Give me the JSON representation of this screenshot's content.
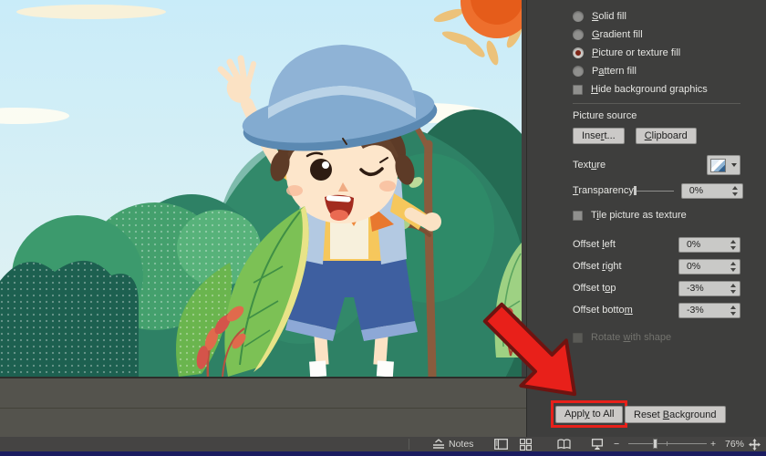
{
  "app": {
    "name": "PowerPoint Format Background pane"
  },
  "panel": {
    "fill_options": [
      {
        "pre": "",
        "mn": "S",
        "post": "olid fill",
        "selected": false
      },
      {
        "pre": "",
        "mn": "G",
        "post": "radient fill",
        "selected": false
      },
      {
        "pre": "",
        "mn": "P",
        "post": "icture or texture fill",
        "selected": true
      },
      {
        "pre": "P",
        "mn": "a",
        "post": "ttern fill",
        "selected": false
      }
    ],
    "selected_fill_option": "Picture or texture fill",
    "hide_bg": {
      "pre": "",
      "mn": "H",
      "post": "ide background graphics",
      "checked": false
    },
    "picture_source_label": "Picture source",
    "insert_btn": {
      "pre": "Inse",
      "mn": "r",
      "post": "t..."
    },
    "clipboard_btn": {
      "pre": "",
      "mn": "C",
      "post": "lipboard"
    },
    "texture_label": {
      "pre": "Text",
      "mn": "u",
      "post": "re"
    },
    "transparency_label": {
      "pre": "",
      "mn": "T",
      "post": "ransparency"
    },
    "transparency_value": "0%",
    "tile_label": {
      "pre": "T",
      "mn": "i",
      "post": "le picture as texture",
      "checked": false
    },
    "offsets": [
      {
        "label": {
          "pre": "Offset ",
          "mn": "l",
          "post": "eft"
        },
        "value": "0%"
      },
      {
        "label": {
          "pre": "Offset ",
          "mn": "r",
          "post": "ight"
        },
        "value": "0%"
      },
      {
        "label": {
          "pre": "Offset t",
          "mn": "o",
          "post": "p"
        },
        "value": "-3%"
      },
      {
        "label": {
          "pre": "Offset botto",
          "mn": "m",
          "post": ""
        },
        "value": "-3%"
      }
    ],
    "rotate_label": {
      "pre": "Rotate ",
      "mn": "w",
      "post": "ith shape",
      "disabled": true
    },
    "apply_btn": {
      "pre": "Appl",
      "mn": "y",
      "post": " to All"
    },
    "reset_btn": {
      "pre": "Reset ",
      "mn": "B",
      "post": "ackground"
    }
  },
  "status_bar": {
    "notes_label": "Notes",
    "zoom_out_glyph": "−",
    "zoom_in_glyph": "+",
    "zoom_level": "76%"
  },
  "icons": {
    "notes": "notes-collapse-icon",
    "normal_view": "normal-view-icon",
    "slide_sorter": "slide-sorter-icon",
    "reading_view": "reading-view-icon",
    "slideshow": "slideshow-icon",
    "fit_to_window": "fit-to-window-icon",
    "texture_dropdown": "texture-thumbnail + chevron-down-icon",
    "annotation": "red-arrow-annotation"
  },
  "colors": {
    "highlight_red": "#e8201a",
    "panel_bg": "#3e3e3d",
    "panel_text": "#e6e6e3",
    "button_bg": "#cbc9c7",
    "radio_selected_dot": "#7e2517",
    "status_bar_bg": "#454443",
    "taskbar_blue": "#1b1c60",
    "sky_blue": "#cfeefb"
  }
}
